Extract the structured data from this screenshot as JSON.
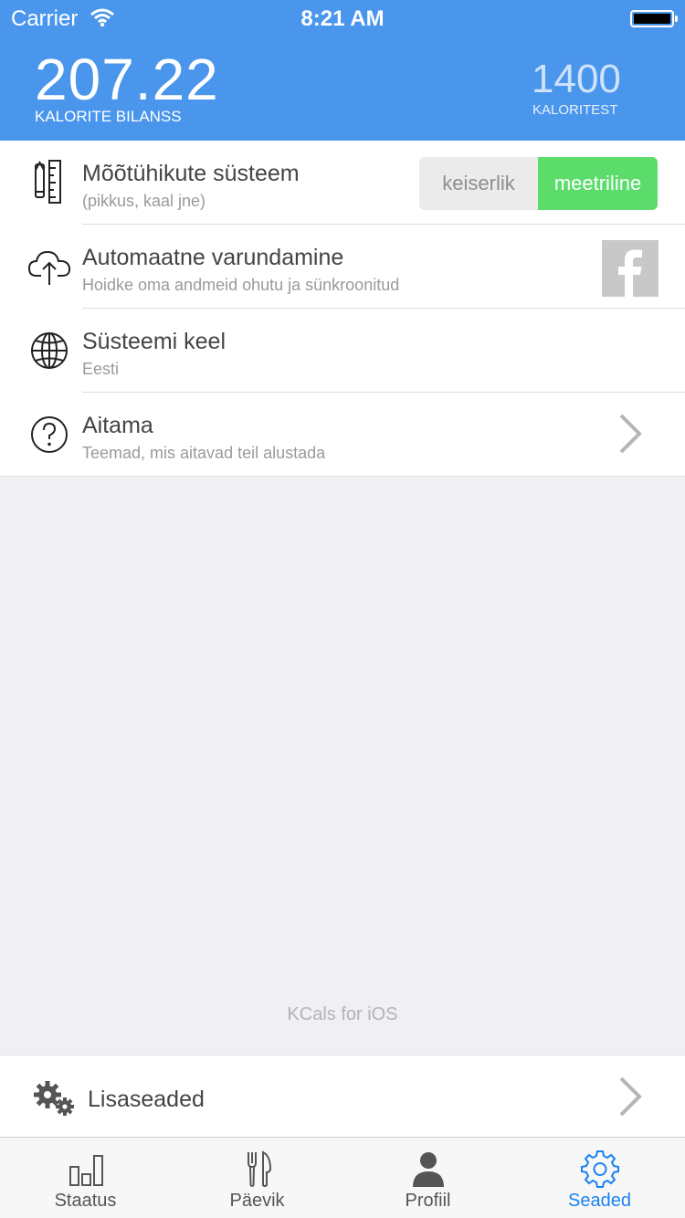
{
  "status_bar": {
    "carrier": "Carrier",
    "time": "8:21 AM"
  },
  "header": {
    "balance_value": "207.22",
    "balance_label": "KALORITE BILANSS",
    "goal_value": "1400",
    "goal_label": "KALORITEST"
  },
  "settings": [
    {
      "title": "Mõõtühikute süsteem",
      "subtitle": "(pikkus, kaal jne)",
      "icon": "ruler-pencil-icon"
    },
    {
      "title": "Automaatne varundamine",
      "subtitle": "Hoidke oma andmeid ohutu ja sünkroonitud",
      "icon": "cloud-upload-icon"
    },
    {
      "title": "Süsteemi keel",
      "subtitle": "Eesti",
      "icon": "globe-icon"
    },
    {
      "title": "Aitama",
      "subtitle": "Teemad, mis aitavad teil alustada",
      "icon": "help-icon"
    }
  ],
  "units_toggle": {
    "options": [
      "keiserlik",
      "meetriline"
    ],
    "selected": "meetriline"
  },
  "footer_text": "KCals for iOS",
  "extra_settings": {
    "label": "Lisaseaded",
    "icon": "gears-icon"
  },
  "tabs": [
    {
      "label": "Staatus",
      "icon": "bar-chart-icon",
      "active": false
    },
    {
      "label": "Päevik",
      "icon": "fork-knife-icon",
      "active": false
    },
    {
      "label": "Profiil",
      "icon": "person-icon",
      "active": false
    },
    {
      "label": "Seaded",
      "icon": "gear-icon",
      "active": true
    }
  ],
  "colors": {
    "header": "#4a96ec",
    "toggle_active": "#5cdc6b",
    "tab_active": "#1a82f0",
    "background": "#efeff4"
  }
}
